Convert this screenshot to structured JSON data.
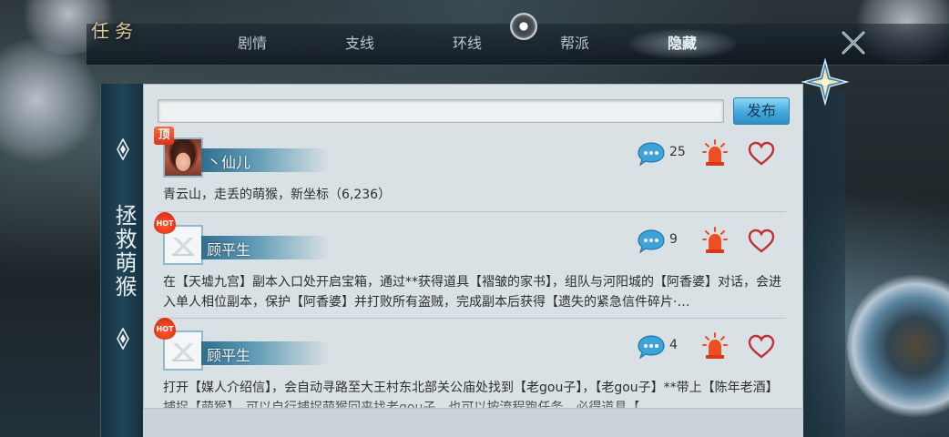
{
  "header": {
    "title": "任务",
    "tabs": [
      {
        "label": "剧情",
        "active": false
      },
      {
        "label": "支线",
        "active": false
      },
      {
        "label": "环线",
        "active": false
      },
      {
        "label": "帮派",
        "active": false
      },
      {
        "label": "隐藏",
        "active": true
      }
    ]
  },
  "sidebar": {
    "title": "拯救萌猴"
  },
  "composer": {
    "input_value": "",
    "publish_label": "发布"
  },
  "posts": [
    {
      "badge": "顶",
      "badge_type": "top",
      "avatar": "photo",
      "user": "丶仙儿",
      "comment_count": "25",
      "body": "青云山，走丢的萌猴，新坐标（6,236）"
    },
    {
      "badge": "HOT",
      "badge_type": "hot",
      "avatar": "placeholder",
      "user": "顾平生",
      "comment_count": "9",
      "body": "在【天墟九宫】副本入口处开启宝箱，通过**获得道具【褶皱的家书】，组队与河阳城的【阿香婆】对话，会进入单人相位副本，保护【阿香婆】并打败所有盗贼，完成副本后获得【遗失的紧急信件碎片·…"
    },
    {
      "badge": "HOT",
      "badge_type": "hot",
      "avatar": "placeholder",
      "user": "顾平生",
      "comment_count": "4",
      "body": "打开【媒人介绍信】，会自动寻路至大王村东北部关公庙处找到【老gou子】，【老gou子】**带上【陈年老酒】捕捉【萌猴】，可以自行捕捉萌猴回来找老gou子，也可以按流程跑任务，必得道具【"
    }
  ],
  "colors": {
    "panel_bg": "#d9e1e4",
    "accent_blue": "#42a9dc",
    "alert_orange": "#e0321a",
    "heart_red": "#c0303a"
  }
}
